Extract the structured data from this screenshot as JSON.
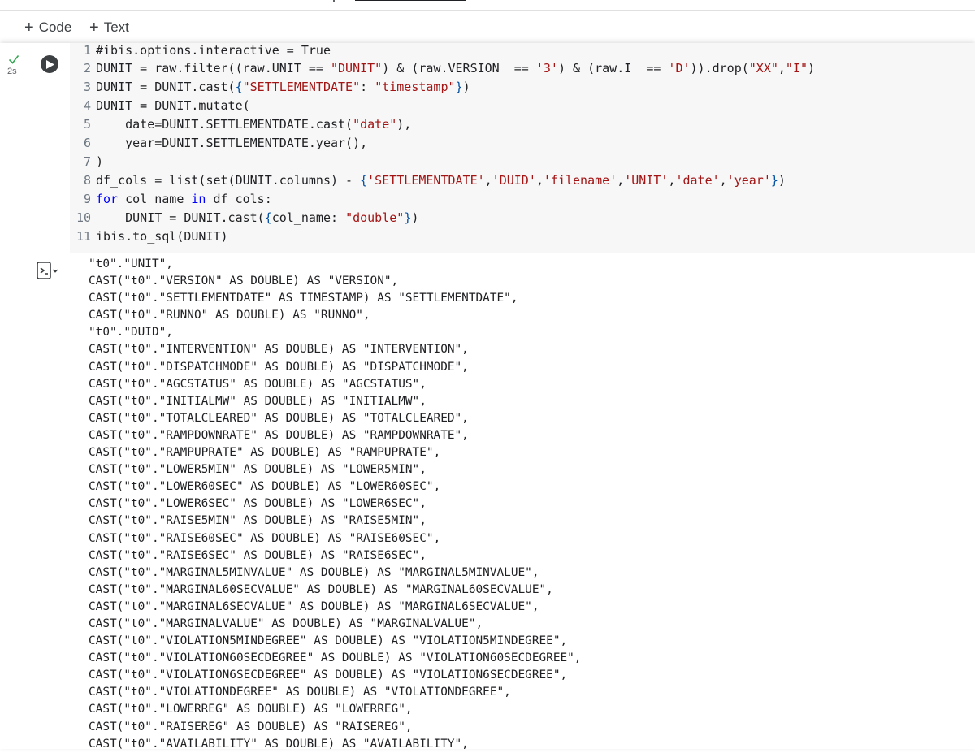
{
  "toolbar": {
    "add_code_label": "Code",
    "add_text_label": "Text"
  },
  "cell": {
    "runtime": "2s",
    "code_lines": [
      {
        "n": "1",
        "indent": "",
        "parts": [
          [
            "",
            "#ibis.options.interactive = True"
          ]
        ]
      },
      {
        "n": "2",
        "indent": "",
        "parts": [
          [
            "",
            "DUNIT = raw.filter((raw.UNIT == "
          ],
          [
            "str",
            "\"DUNIT\""
          ],
          [
            "",
            ") & (raw.VERSION  == "
          ],
          [
            "str",
            "'3'"
          ],
          [
            "",
            ") & (raw.I  == "
          ],
          [
            "str",
            "'D'"
          ],
          [
            "",
            ")).drop("
          ],
          [
            "str",
            "\"XX\""
          ],
          [
            "",
            ","
          ],
          [
            "str",
            "\"I\""
          ],
          [
            "",
            ")"
          ]
        ]
      },
      {
        "n": "3",
        "indent": "",
        "parts": [
          [
            "",
            "DUNIT = DUNIT.cast("
          ],
          [
            "br",
            "{"
          ],
          [
            "str",
            "\"SETTLEMENTDATE\""
          ],
          [
            "",
            ": "
          ],
          [
            "str",
            "\"timestamp\""
          ],
          [
            "br",
            "}"
          ],
          [
            "",
            ")"
          ]
        ]
      },
      {
        "n": "4",
        "indent": "",
        "parts": [
          [
            "",
            "DUNIT = DUNIT.mutate("
          ]
        ]
      },
      {
        "n": "5",
        "indent": "    ",
        "parts": [
          [
            "",
            "date=DUNIT.SETTLEMENTDATE.cast("
          ],
          [
            "str",
            "\"date\""
          ],
          [
            "",
            "),"
          ]
        ]
      },
      {
        "n": "6",
        "indent": "    ",
        "parts": [
          [
            "",
            "year=DUNIT.SETTLEMENTDATE.year(),"
          ]
        ]
      },
      {
        "n": "7",
        "indent": "",
        "parts": [
          [
            "",
            ")"
          ]
        ]
      },
      {
        "n": "8",
        "indent": "",
        "parts": [
          [
            "",
            "df_cols = list(set(DUNIT.columns) - "
          ],
          [
            "br",
            "{"
          ],
          [
            "str",
            "'SETTLEMENTDATE'"
          ],
          [
            "",
            ","
          ],
          [
            "str",
            "'DUID'"
          ],
          [
            "",
            ","
          ],
          [
            "str",
            "'filename'"
          ],
          [
            "",
            ","
          ],
          [
            "str",
            "'UNIT'"
          ],
          [
            "",
            ","
          ],
          [
            "str",
            "'date'"
          ],
          [
            "",
            ","
          ],
          [
            "str",
            "'year'"
          ],
          [
            "br",
            "}"
          ],
          [
            "",
            ")"
          ]
        ]
      },
      {
        "n": "9",
        "indent": "",
        "parts": [
          [
            "kw",
            "for"
          ],
          [
            "",
            " col_name "
          ],
          [
            "kw",
            "in"
          ],
          [
            "",
            " df_cols:"
          ]
        ]
      },
      {
        "n": "10",
        "indent": "    ",
        "parts": [
          [
            "",
            "DUNIT = DUNIT.cast("
          ],
          [
            "br",
            "{"
          ],
          [
            "",
            "col_name: "
          ],
          [
            "str",
            "\"double\""
          ],
          [
            "br",
            "}"
          ],
          [
            "",
            ")"
          ]
        ]
      },
      {
        "n": "11",
        "indent": "",
        "parts": [
          [
            "",
            "ibis.to_sql(DUNIT)"
          ]
        ]
      }
    ]
  },
  "output": {
    "lines": [
      "\"t0\".\"UNIT\",",
      "CAST(\"t0\".\"VERSION\" AS DOUBLE) AS \"VERSION\",",
      "CAST(\"t0\".\"SETTLEMENTDATE\" AS TIMESTAMP) AS \"SETTLEMENTDATE\",",
      "CAST(\"t0\".\"RUNNO\" AS DOUBLE) AS \"RUNNO\",",
      "\"t0\".\"DUID\",",
      "CAST(\"t0\".\"INTERVENTION\" AS DOUBLE) AS \"INTERVENTION\",",
      "CAST(\"t0\".\"DISPATCHMODE\" AS DOUBLE) AS \"DISPATCHMODE\",",
      "CAST(\"t0\".\"AGCSTATUS\" AS DOUBLE) AS \"AGCSTATUS\",",
      "CAST(\"t0\".\"INITIALMW\" AS DOUBLE) AS \"INITIALMW\",",
      "CAST(\"t0\".\"TOTALCLEARED\" AS DOUBLE) AS \"TOTALCLEARED\",",
      "CAST(\"t0\".\"RAMPDOWNRATE\" AS DOUBLE) AS \"RAMPDOWNRATE\",",
      "CAST(\"t0\".\"RAMPUPRATE\" AS DOUBLE) AS \"RAMPUPRATE\",",
      "CAST(\"t0\".\"LOWER5MIN\" AS DOUBLE) AS \"LOWER5MIN\",",
      "CAST(\"t0\".\"LOWER60SEC\" AS DOUBLE) AS \"LOWER60SEC\",",
      "CAST(\"t0\".\"LOWER6SEC\" AS DOUBLE) AS \"LOWER6SEC\",",
      "CAST(\"t0\".\"RAISE5MIN\" AS DOUBLE) AS \"RAISE5MIN\",",
      "CAST(\"t0\".\"RAISE60SEC\" AS DOUBLE) AS \"RAISE60SEC\",",
      "CAST(\"t0\".\"RAISE6SEC\" AS DOUBLE) AS \"RAISE6SEC\",",
      "CAST(\"t0\".\"MARGINAL5MINVALUE\" AS DOUBLE) AS \"MARGINAL5MINVALUE\",",
      "CAST(\"t0\".\"MARGINAL60SECVALUE\" AS DOUBLE) AS \"MARGINAL60SECVALUE\",",
      "CAST(\"t0\".\"MARGINAL6SECVALUE\" AS DOUBLE) AS \"MARGINAL6SECVALUE\",",
      "CAST(\"t0\".\"MARGINALVALUE\" AS DOUBLE) AS \"MARGINALVALUE\",",
      "CAST(\"t0\".\"VIOLATION5MINDEGREE\" AS DOUBLE) AS \"VIOLATION5MINDEGREE\",",
      "CAST(\"t0\".\"VIOLATION60SECDEGREE\" AS DOUBLE) AS \"VIOLATION60SECDEGREE\",",
      "CAST(\"t0\".\"VIOLATION6SECDEGREE\" AS DOUBLE) AS \"VIOLATION6SECDEGREE\",",
      "CAST(\"t0\".\"VIOLATIONDEGREE\" AS DOUBLE) AS \"VIOLATIONDEGREE\",",
      "CAST(\"t0\".\"LOWERREG\" AS DOUBLE) AS \"LOWERREG\",",
      "CAST(\"t0\".\"RAISEREG\" AS DOUBLE) AS \"RAISEREG\",",
      "CAST(\"t0\".\"AVAILABILITY\" AS DOUBLE) AS \"AVAILABILITY\","
    ]
  },
  "colors": {
    "keyword": "#0000ff",
    "string": "#a31515",
    "bracket": "#0451a5",
    "success_check": "#34a853",
    "editor_bg": "#f7f7f7"
  },
  "icons": {
    "add_code": "plus-icon",
    "add_text": "plus-icon",
    "status": "check-icon",
    "run": "play-icon",
    "output_menu": "output-actions-icon"
  }
}
